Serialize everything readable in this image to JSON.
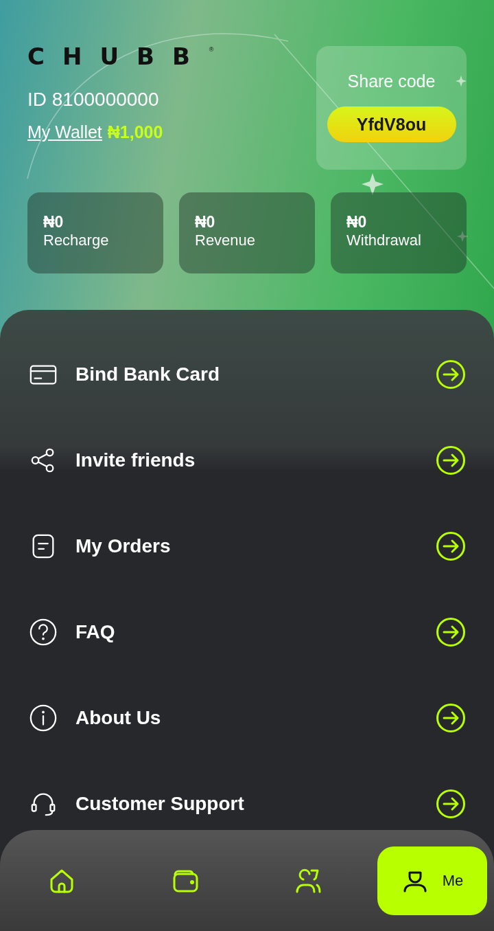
{
  "header": {
    "logo": "CHUBB",
    "logo_mark": "®",
    "user_id": "ID 8100000000",
    "wallet_link": "My Wallet",
    "wallet_balance": "₦1,000"
  },
  "share": {
    "title": "Share code",
    "code": "YfdV8ou"
  },
  "stats": [
    {
      "amount": "₦0",
      "label": "Recharge"
    },
    {
      "amount": "₦0",
      "label": "Revenue"
    },
    {
      "amount": "₦0",
      "label": "Withdrawal"
    }
  ],
  "menu": [
    {
      "kind": "card",
      "label": "Bind Bank Card"
    },
    {
      "kind": "share",
      "label": "Invite friends"
    },
    {
      "kind": "orders",
      "label": "My Orders"
    },
    {
      "kind": "question",
      "label": "FAQ"
    },
    {
      "kind": "info",
      "label": "About Us"
    },
    {
      "kind": "headset",
      "label": "Customer Support"
    }
  ],
  "nav": [
    {
      "kind": "home",
      "selected": false
    },
    {
      "kind": "wallet",
      "selected": false
    },
    {
      "kind": "team",
      "selected": false
    },
    {
      "kind": "person",
      "label": "Me",
      "selected": true
    }
  ]
}
